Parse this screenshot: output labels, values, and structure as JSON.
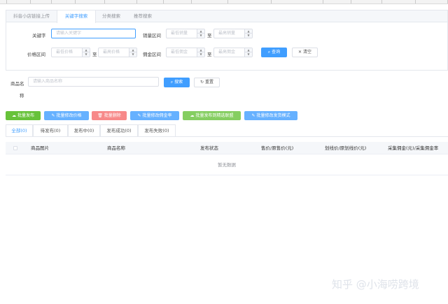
{
  "tabs": [
    {
      "label": "抖音小店链接上传",
      "active": false
    },
    {
      "label": "关键字搜索",
      "active": true
    },
    {
      "label": "分类搜索",
      "active": false
    },
    {
      "label": "推荐搜索",
      "active": false
    }
  ],
  "filters": {
    "keyword_label": "关键字",
    "keyword_placeholder": "请输入关键字",
    "sales_label": "销量区间",
    "sales_min_placeholder": "最低销量",
    "sales_max_placeholder": "最高销量",
    "price_label": "价格区间",
    "price_min_placeholder": "最低价格",
    "price_max_placeholder": "最高价格",
    "commission_label": "佣金区间",
    "commission_min_placeholder": "最低佣金",
    "commission_max_placeholder": "最高佣金",
    "range_sep": "至",
    "query_label": "查询",
    "clear_label": "清空"
  },
  "product_search": {
    "label_line1": "商品名",
    "label_line2": "称",
    "placeholder": "请输入商品名称",
    "search_label": "搜索",
    "reset_label": "重置"
  },
  "bulk_actions": [
    {
      "label": "批量发布",
      "color": "#67c23a"
    },
    {
      "label": "批量修改价格",
      "color": "#66b1ff"
    },
    {
      "label": "批量删除",
      "color": "#f78989"
    },
    {
      "label": "批量修改佣金率",
      "color": "#66b1ff"
    },
    {
      "label": "批量发布到精选联盟",
      "color": "#85ce61"
    },
    {
      "label": "批量修改发货模式",
      "color": "#66b1ff"
    }
  ],
  "status_tabs": [
    {
      "label": "全部(0)",
      "active": true
    },
    {
      "label": "待发布(0)",
      "active": false
    },
    {
      "label": "发布中(0)",
      "active": false
    },
    {
      "label": "发布成功(0)",
      "active": false
    },
    {
      "label": "发布失败(0)",
      "active": false
    }
  ],
  "table": {
    "columns": [
      "商品图片",
      "商品名称",
      "发布状态",
      "售价/原售价(元)",
      "划线价/原划线价(元)",
      "采集佣金(元)/采集佣金率"
    ],
    "empty_text": "暂无数据"
  },
  "watermark": "知乎 @小海唠跨境",
  "colors": {
    "primary": "#409eff",
    "border": "#dcdfe6"
  }
}
